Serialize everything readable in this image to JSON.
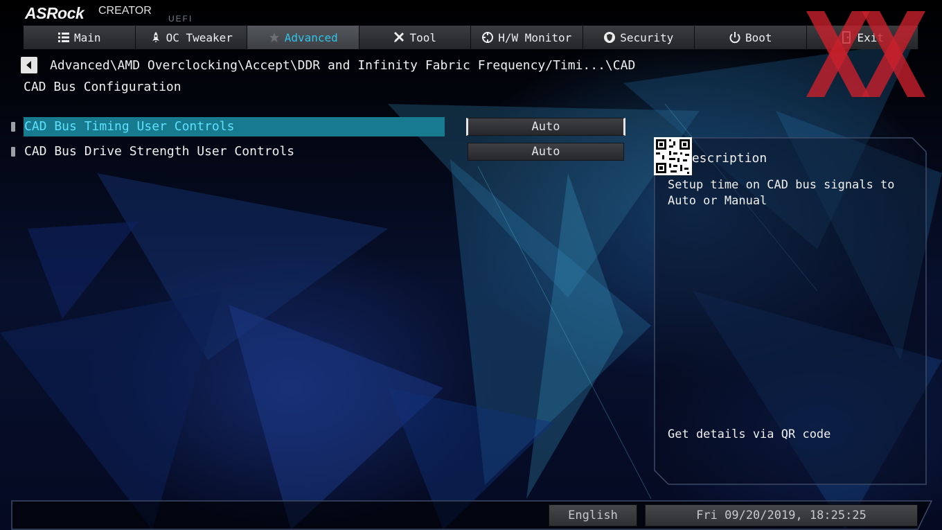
{
  "logo": {
    "brand": "ASRock",
    "product": "CREATOR",
    "subtitle": "UEFI"
  },
  "nav": {
    "tabs": [
      {
        "label": "Main",
        "icon": "list-icon"
      },
      {
        "label": "OC Tweaker",
        "icon": "rocket-icon"
      },
      {
        "label": "Advanced",
        "icon": "star-icon",
        "active": true
      },
      {
        "label": "Tool",
        "icon": "tools-icon"
      },
      {
        "label": "H/W Monitor",
        "icon": "crosshair-icon"
      },
      {
        "label": "Security",
        "icon": "shield-icon"
      },
      {
        "label": "Boot",
        "icon": "power-icon"
      },
      {
        "label": "Exit",
        "icon": "exit-door-icon"
      }
    ]
  },
  "breadcrumb": "Advanced\\AMD Overclocking\\Accept\\DDR and Infinity Fabric Frequency/Timi...\\CAD",
  "page_title": "CAD Bus Configuration",
  "settings": [
    {
      "label": "CAD Bus Timing User Controls",
      "value": "Auto",
      "selected": true
    },
    {
      "label": "CAD Bus Drive Strength User Controls",
      "value": "Auto",
      "selected": false
    }
  ],
  "description": {
    "title": "Description",
    "text": "Setup time on CAD bus signals to Auto or Manual",
    "qr_label": "Get details via QR code"
  },
  "footer": {
    "language": "English",
    "datetime": "Fri 09/20/2019, 18:25:25"
  },
  "colors": {
    "accent": "#2ec4e8",
    "selected_row": "#177a8e",
    "watermark": "#c8202c"
  }
}
